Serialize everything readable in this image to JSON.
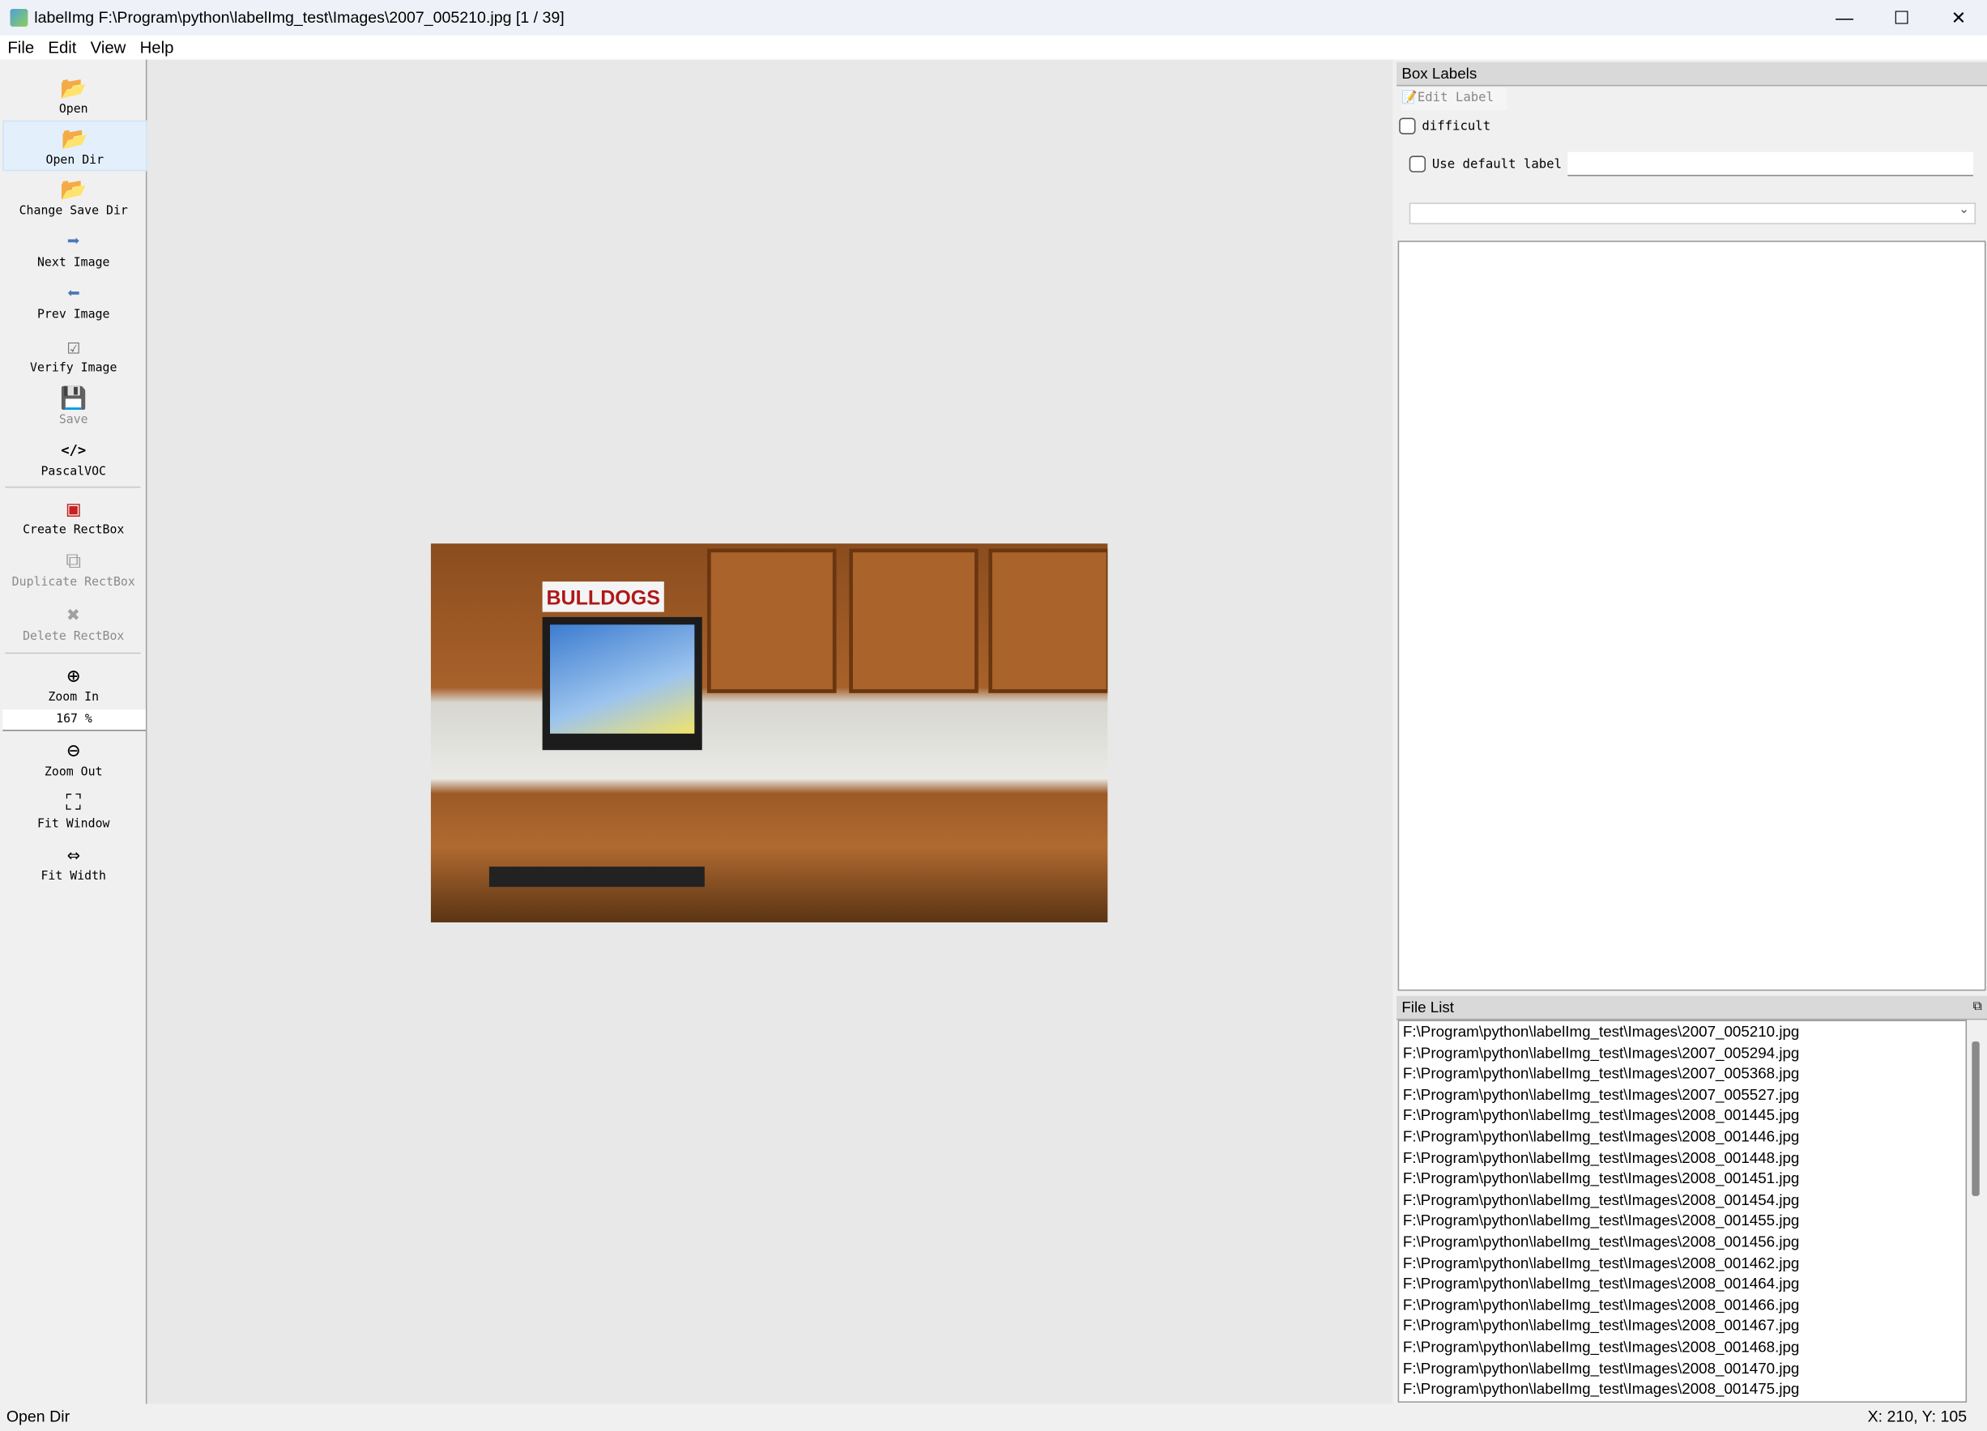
{
  "window": {
    "title": "labelImg F:\\Program\\python\\labelImg_test\\Images\\2007_005210.jpg [1 / 39]",
    "minimize": "—",
    "maximize": "☐",
    "close": "✕"
  },
  "menu": [
    "File",
    "Edit",
    "View",
    "Help"
  ],
  "toolbar": {
    "open": "Open",
    "open_dir": "Open Dir",
    "change_save_dir": "Change Save Dir",
    "next_image": "Next Image",
    "prev_image": "Prev Image",
    "verify_image": "Verify Image",
    "save": "Save",
    "format_icon": "</>",
    "format": "PascalVOC",
    "create_rectbox": "Create RectBox",
    "duplicate_rectbox": "Duplicate RectBox",
    "delete_rectbox": "Delete RectBox",
    "zoom_in": "Zoom In",
    "zoom_value": "167 %",
    "zoom_out": "Zoom Out",
    "fit_window": "Fit Window",
    "fit_width": "Fit Width"
  },
  "image": {
    "sign_text": "BULLDOGS"
  },
  "box_labels": {
    "title": "Box Labels",
    "edit_label": "Edit Label",
    "difficult": "difficult",
    "use_default_label": "Use default label",
    "default_label_value": "",
    "combo_value": ""
  },
  "file_list": {
    "title": "File List",
    "files": [
      "F:\\Program\\python\\labelImg_test\\Images\\2007_005210.jpg",
      "F:\\Program\\python\\labelImg_test\\Images\\2007_005294.jpg",
      "F:\\Program\\python\\labelImg_test\\Images\\2007_005368.jpg",
      "F:\\Program\\python\\labelImg_test\\Images\\2007_005527.jpg",
      "F:\\Program\\python\\labelImg_test\\Images\\2008_001445.jpg",
      "F:\\Program\\python\\labelImg_test\\Images\\2008_001446.jpg",
      "F:\\Program\\python\\labelImg_test\\Images\\2008_001448.jpg",
      "F:\\Program\\python\\labelImg_test\\Images\\2008_001451.jpg",
      "F:\\Program\\python\\labelImg_test\\Images\\2008_001454.jpg",
      "F:\\Program\\python\\labelImg_test\\Images\\2008_001455.jpg",
      "F:\\Program\\python\\labelImg_test\\Images\\2008_001456.jpg",
      "F:\\Program\\python\\labelImg_test\\Images\\2008_001462.jpg",
      "F:\\Program\\python\\labelImg_test\\Images\\2008_001464.jpg",
      "F:\\Program\\python\\labelImg_test\\Images\\2008_001466.jpg",
      "F:\\Program\\python\\labelImg_test\\Images\\2008_001467.jpg",
      "F:\\Program\\python\\labelImg_test\\Images\\2008_001468.jpg",
      "F:\\Program\\python\\labelImg_test\\Images\\2008_001470.jpg",
      "F:\\Program\\python\\labelImg_test\\Images\\2008_001475.jpg"
    ]
  },
  "status": {
    "message": "Open Dir",
    "coords": "X: 210, Y: 105"
  }
}
